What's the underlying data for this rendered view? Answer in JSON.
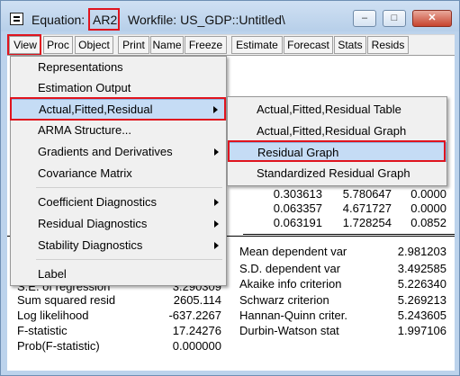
{
  "window": {
    "title_prefix": "Equation:",
    "equation_name": "AR2",
    "workfile": "Workfile: US_GDP::Untitled\\",
    "buttons": [
      "–",
      "□",
      "✕"
    ]
  },
  "toolbar": {
    "buttons": [
      "View",
      "Proc",
      "Object",
      "Print",
      "Name",
      "Freeze",
      "Estimate",
      "Forecast",
      "Stats",
      "Resids"
    ]
  },
  "view_menu": {
    "items": [
      {
        "label": "Representations"
      },
      {
        "label": "Estimation Output"
      },
      {
        "label": "Actual,Fitted,Residual"
      },
      {
        "label": "ARMA Structure..."
      },
      {
        "label": "Gradients and Derivatives"
      },
      {
        "label": "Covariance Matrix"
      },
      {
        "label": "Coefficient Diagnostics"
      },
      {
        "label": "Residual Diagnostics"
      },
      {
        "label": "Stability Diagnostics"
      },
      {
        "label": "Label"
      }
    ]
  },
  "submenu": {
    "items": [
      {
        "label": "Actual,Fitted,Residual Table"
      },
      {
        "label": "Actual,Fitted,Residual Graph"
      },
      {
        "label": "Residual Graph"
      },
      {
        "label": "Standardized Residual Graph"
      }
    ]
  },
  "coef_rows": [
    [
      "0.303613",
      "5.780647",
      "0.0000"
    ],
    [
      "0.063357",
      "4.671727",
      "0.0000"
    ],
    [
      "0.063191",
      "1.728254",
      "0.0852"
    ]
  ],
  "stats_left": [
    {
      "label": "S.E. of regression",
      "value": "3.290309"
    },
    {
      "label": "Sum squared resid",
      "value": "2605.114"
    },
    {
      "label": "Log likelihood",
      "value": "-637.2267"
    },
    {
      "label": "F-statistic",
      "value": "17.24276"
    },
    {
      "label": "Prob(F-statistic)",
      "value": "0.000000"
    }
  ],
  "stats_right": [
    {
      "label": "Mean dependent var",
      "value": "2.981203"
    },
    {
      "label": "S.D. dependent var",
      "value": "3.492585"
    },
    {
      "label": "Akaike info criterion",
      "value": "5.226340"
    },
    {
      "label": "Schwarz criterion",
      "value": "5.269213"
    },
    {
      "label": "Hannan-Quinn criter.",
      "value": "5.243605"
    },
    {
      "label": "Durbin-Watson stat",
      "value": "1.997106"
    }
  ],
  "colors": {
    "highlight_box": "#e0141e",
    "menu_highlight": "#c5dcf5",
    "title_bar": "#bcd3ec"
  }
}
